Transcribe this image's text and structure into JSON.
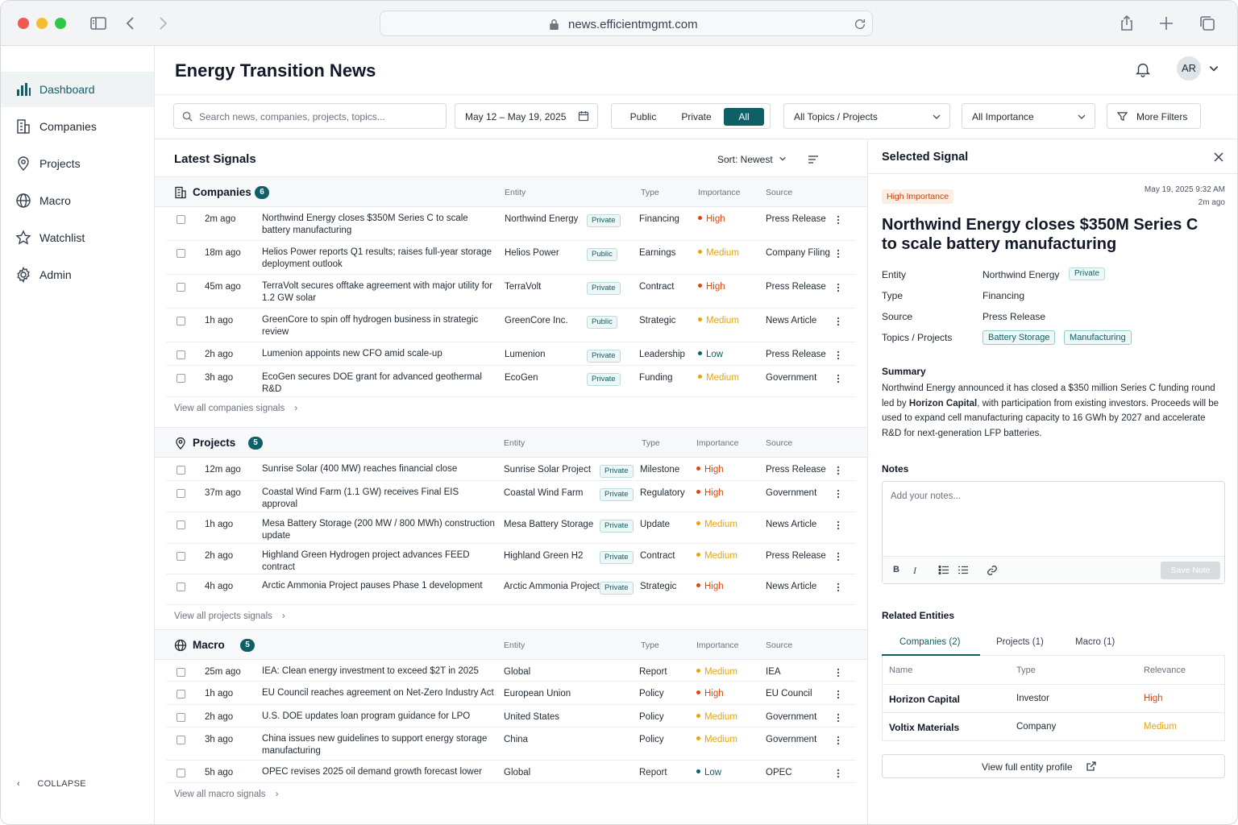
{
  "browser": {
    "url": "news.efficientmgmt.com"
  },
  "sidebar": {
    "items": [
      {
        "label": "Dashboard",
        "icon": "bar-chart-icon"
      },
      {
        "label": "Companies",
        "icon": "building-icon"
      },
      {
        "label": "Projects",
        "icon": "map-pin-icon"
      },
      {
        "label": "Macro",
        "icon": "globe-icon"
      },
      {
        "label": "Watchlist",
        "icon": "star-icon"
      },
      {
        "label": "Admin",
        "icon": "gear-icon"
      }
    ],
    "collapse_label": "COLLAPSE"
  },
  "header": {
    "title": "Energy Transition News",
    "avatar_initials": "AR"
  },
  "filters": {
    "search_placeholder": "Search news, companies, projects, topics...",
    "date_range": "May 12 – May 19, 2025",
    "segments": [
      "Public",
      "Private",
      "All"
    ],
    "topics": "All Topics / Projects",
    "importance": "All Importance",
    "more": "More Filters"
  },
  "latest": {
    "title": "Latest Signals",
    "sort": "Sort: Newest",
    "columns": {
      "entity": "Entity",
      "type": "Type",
      "importance": "Importance",
      "source": "Source"
    },
    "groups": [
      {
        "name": "Companies",
        "count": "6",
        "view_all": "View all companies signals",
        "rows": [
          {
            "time": "2m ago",
            "headline": "Northwind Energy closes $350M Series C to scale battery manufacturing",
            "entity": "Northwind Energy",
            "badge": "Private",
            "type": "Financing",
            "importance": "High",
            "source": "Press Release"
          },
          {
            "time": "18m ago",
            "headline": "Helios Power reports Q1 results; raises full-year storage deployment outlook",
            "entity": "Helios Power",
            "badge": "Public",
            "type": "Earnings",
            "importance": "Medium",
            "source": "Company Filing"
          },
          {
            "time": "45m ago",
            "headline": "TerraVolt secures offtake agreement with major utility for 1.2 GW solar",
            "entity": "TerraVolt",
            "badge": "Private",
            "type": "Contract",
            "importance": "High",
            "source": "Press Release"
          },
          {
            "time": "1h ago",
            "headline": "GreenCore to spin off hydrogen business in strategic review",
            "entity": "GreenCore Inc.",
            "badge": "Public",
            "type": "Strategic",
            "importance": "Medium",
            "source": "News Article"
          },
          {
            "time": "2h ago",
            "headline": "Lumenion appoints new CFO amid scale-up",
            "entity": "Lumenion",
            "badge": "Private",
            "type": "Leadership",
            "importance": "Low",
            "source": "Press Release"
          },
          {
            "time": "3h ago",
            "headline": "EcoGen secures DOE grant for advanced geothermal R&D",
            "entity": "EcoGen",
            "badge": "Private",
            "type": "Funding",
            "importance": "Medium",
            "source": "Government"
          }
        ]
      },
      {
        "name": "Projects",
        "count": "5",
        "view_all": "View all projects signals",
        "rows": [
          {
            "time": "12m ago",
            "headline": "Sunrise Solar (400 MW) reaches financial close",
            "entity": "Sunrise Solar Project",
            "badge": "Private",
            "type": "Milestone",
            "importance": "High",
            "source": "Press Release"
          },
          {
            "time": "37m ago",
            "headline": "Coastal Wind Farm (1.1 GW) receives Final EIS approval",
            "entity": "Coastal Wind Farm",
            "badge": "Private",
            "type": "Regulatory",
            "importance": "High",
            "source": "Government"
          },
          {
            "time": "1h ago",
            "headline": "Mesa Battery Storage (200 MW / 800 MWh) construction update",
            "entity": "Mesa Battery Storage",
            "badge": "Private",
            "type": "Update",
            "importance": "Medium",
            "source": "News Article"
          },
          {
            "time": "2h ago",
            "headline": "Highland Green Hydrogen project advances FEED contract",
            "entity": "Highland Green H2",
            "badge": "Private",
            "type": "Contract",
            "importance": "Medium",
            "source": "Press Release"
          },
          {
            "time": "4h ago",
            "headline": "Arctic Ammonia Project pauses Phase 1 development",
            "entity": "Arctic Ammonia Project",
            "badge": "Private",
            "type": "Strategic",
            "importance": "High",
            "source": "News Article"
          }
        ]
      },
      {
        "name": "Macro",
        "count": "5",
        "view_all": "View all macro signals",
        "rows": [
          {
            "time": "25m ago",
            "headline": "IEA: Clean energy investment to exceed $2T in 2025",
            "entity": "Global",
            "badge": "",
            "type": "Report",
            "importance": "Medium",
            "source": "IEA"
          },
          {
            "time": "1h ago",
            "headline": "EU Council reaches agreement on Net-Zero Industry Act",
            "entity": "European Union",
            "badge": "",
            "type": "Policy",
            "importance": "High",
            "source": "EU Council"
          },
          {
            "time": "2h ago",
            "headline": "U.S. DOE updates loan program guidance for LPO",
            "entity": "United States",
            "badge": "",
            "type": "Policy",
            "importance": "Medium",
            "source": "Government"
          },
          {
            "time": "3h ago",
            "headline": "China issues new guidelines to support energy storage manufacturing",
            "entity": "China",
            "badge": "",
            "type": "Policy",
            "importance": "Medium",
            "source": "Government"
          },
          {
            "time": "5h ago",
            "headline": "OPEC revises 2025 oil demand growth forecast lower",
            "entity": "Global",
            "badge": "",
            "type": "Report",
            "importance": "Low",
            "source": "OPEC"
          }
        ]
      }
    ]
  },
  "detail": {
    "title": "Selected Signal",
    "importance_badge": "High Importance",
    "date": "May 19, 2025 9:32 AM",
    "ago": "2m ago",
    "headline": "Northwind Energy closes $350M Series C to scale battery manufacturing",
    "fields": {
      "entity_label": "Entity",
      "entity": "Northwind Energy",
      "entity_badge": "Private",
      "type_label": "Type",
      "type": "Financing",
      "source_label": "Source",
      "source": "Press Release",
      "topics_label": "Topics / Projects",
      "topics": [
        "Battery Storage",
        "Manufacturing"
      ]
    },
    "summary_label": "Summary",
    "summary_1": "Northwind Energy announced it has closed a $350 million Series C funding round led by ",
    "summary_bold": "Horizon Capital",
    "summary_2": ", with participation from existing investors. Proceeds will be used to expand cell manufacturing capacity to 16 GWh by 2027 and accelerate R&D for next-generation LFP batteries.",
    "notes_label": "Notes",
    "notes_placeholder": "Add your notes...",
    "save_note": "Save Note",
    "related_label": "Related Entities",
    "related_tabs": [
      "Companies (2)",
      "Projects (1)",
      "Macro (1)"
    ],
    "related_columns": [
      "Name",
      "Type",
      "Relevance"
    ],
    "related_rows": [
      {
        "name": "Horizon Capital",
        "type": "Investor",
        "relevance": "High"
      },
      {
        "name": "Voltix Materials",
        "type": "Company",
        "relevance": "Medium"
      }
    ],
    "profile_button": "View full entity profile"
  },
  "colors": {
    "accent": "#0e5f66",
    "high": "#d9480f",
    "medium": "#e8a40c",
    "low": "#0e5f66"
  }
}
